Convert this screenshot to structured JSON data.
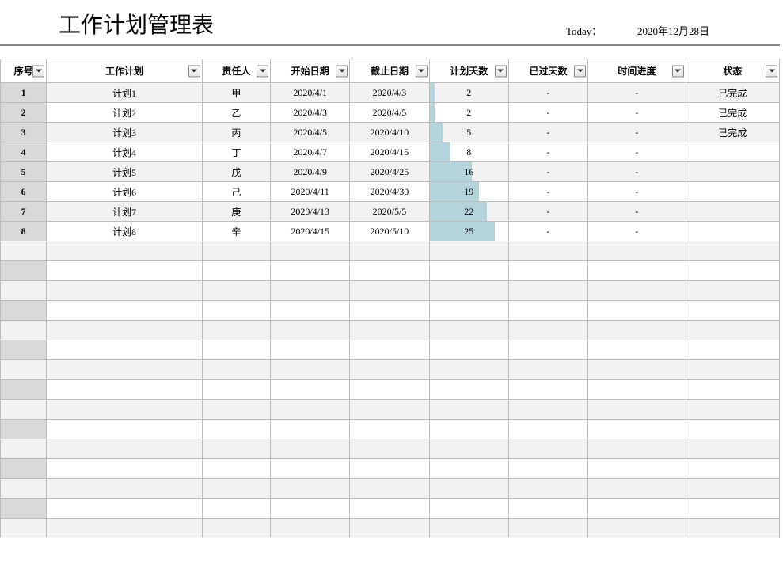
{
  "header": {
    "title": "工作计划管理表",
    "today_label": "Today：",
    "today_value": "2020年12月28日"
  },
  "columns": {
    "seq": "序号",
    "plan": "工作计划",
    "owner": "责任人",
    "start": "开始日期",
    "end": "截止日期",
    "days": "计划天数",
    "past": "已过天数",
    "prog": "时间进度",
    "status": "状态"
  },
  "max_days": 30,
  "rows": [
    {
      "seq": "1",
      "plan": "计划1",
      "owner": "甲",
      "start": "2020/4/1",
      "end": "2020/4/3",
      "days": "2",
      "past": "-",
      "prog": "-",
      "status": "已完成",
      "alt": true
    },
    {
      "seq": "2",
      "plan": "计划2",
      "owner": "乙",
      "start": "2020/4/3",
      "end": "2020/4/5",
      "days": "2",
      "past": "-",
      "prog": "-",
      "status": "已完成",
      "alt": false
    },
    {
      "seq": "3",
      "plan": "计划3",
      "owner": "丙",
      "start": "2020/4/5",
      "end": "2020/4/10",
      "days": "5",
      "past": "-",
      "prog": "-",
      "status": "已完成",
      "alt": true
    },
    {
      "seq": "4",
      "plan": "计划4",
      "owner": "丁",
      "start": "2020/4/7",
      "end": "2020/4/15",
      "days": "8",
      "past": "-",
      "prog": "-",
      "status": "",
      "alt": false
    },
    {
      "seq": "5",
      "plan": "计划5",
      "owner": "戊",
      "start": "2020/4/9",
      "end": "2020/4/25",
      "days": "16",
      "past": "-",
      "prog": "-",
      "status": "",
      "alt": true
    },
    {
      "seq": "6",
      "plan": "计划6",
      "owner": "己",
      "start": "2020/4/11",
      "end": "2020/4/30",
      "days": "19",
      "past": "-",
      "prog": "-",
      "status": "",
      "alt": false
    },
    {
      "seq": "7",
      "plan": "计划7",
      "owner": "庚",
      "start": "2020/4/13",
      "end": "2020/5/5",
      "days": "22",
      "past": "-",
      "prog": "-",
      "status": "",
      "alt": true
    },
    {
      "seq": "8",
      "plan": "计划8",
      "owner": "辛",
      "start": "2020/4/15",
      "end": "2020/5/10",
      "days": "25",
      "past": "-",
      "prog": "-",
      "status": "",
      "alt": false
    }
  ],
  "empty_row_count": 15,
  "chart_data": {
    "type": "table",
    "title": "工作计划管理表",
    "columns": [
      "序号",
      "工作计划",
      "责任人",
      "开始日期",
      "截止日期",
      "计划天数",
      "已过天数",
      "时间进度",
      "状态"
    ],
    "rows": [
      [
        "1",
        "计划1",
        "甲",
        "2020/4/1",
        "2020/4/3",
        2,
        "-",
        "-",
        "已完成"
      ],
      [
        "2",
        "计划2",
        "乙",
        "2020/4/3",
        "2020/4/5",
        2,
        "-",
        "-",
        "已完成"
      ],
      [
        "3",
        "计划3",
        "丙",
        "2020/4/5",
        "2020/4/10",
        5,
        "-",
        "-",
        "已完成"
      ],
      [
        "4",
        "计划4",
        "丁",
        "2020/4/7",
        "2020/4/15",
        8,
        "-",
        "-",
        ""
      ],
      [
        "5",
        "计划5",
        "戊",
        "2020/4/9",
        "2020/4/25",
        16,
        "-",
        "-",
        ""
      ],
      [
        "6",
        "计划6",
        "己",
        "2020/4/11",
        "2020/4/30",
        19,
        "-",
        "-",
        ""
      ],
      [
        "7",
        "计划7",
        "庚",
        "2020/4/13",
        "2020/5/5",
        22,
        "-",
        "-",
        ""
      ],
      [
        "8",
        "计划8",
        "辛",
        "2020/4/15",
        "2020/5/10",
        25,
        "-",
        "-",
        ""
      ]
    ]
  }
}
